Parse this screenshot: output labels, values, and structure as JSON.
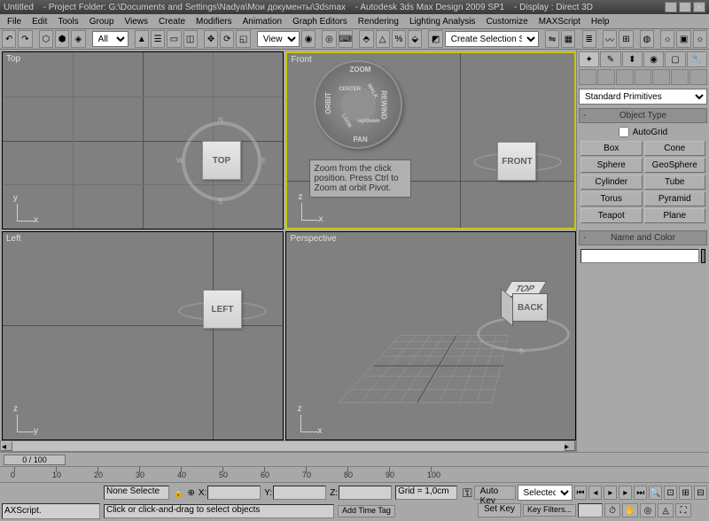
{
  "titlebar": {
    "untitled": "Untitled",
    "project": "- Project Folder: G:\\Documents and Settings\\Nadya\\Мои документы\\3dsmax",
    "app": "- Autodesk 3ds Max Design 2009 SP1",
    "display": "- Display : Direct 3D"
  },
  "menu": [
    "File",
    "Edit",
    "Tools",
    "Group",
    "Views",
    "Create",
    "Modifiers",
    "Animation",
    "Graph Editors",
    "Rendering",
    "Lighting Analysis",
    "Customize",
    "MAXScript",
    "Help"
  ],
  "toolbar": {
    "all_dropdown": "All",
    "view_dropdown": "View",
    "selection_set": "Create Selection Set"
  },
  "viewports": {
    "top": {
      "label": "Top",
      "cube": "TOP"
    },
    "front": {
      "label": "Front",
      "cube": "FRONT"
    },
    "left": {
      "label": "Left",
      "cube": "LEFT"
    },
    "perspective": {
      "label": "Perspective",
      "cube_top": "TOP",
      "cube_back": "BACK"
    }
  },
  "steering_wheel": {
    "segments": [
      "ZOOM",
      "REWIND",
      "PAN",
      "ORBIT",
      "CENTER",
      "WALK",
      "LOOK",
      "up/down"
    ],
    "tooltip": "Zoom from the click position. Press Ctrl to Zoom at orbit Pivot."
  },
  "compass": [
    "N",
    "E",
    "S",
    "W"
  ],
  "command_panel": {
    "dropdown": "Standard Primitives",
    "object_type": "Object Type",
    "autogrid": "AutoGrid",
    "buttons": [
      "Box",
      "Cone",
      "Sphere",
      "GeoSphere",
      "Cylinder",
      "Tube",
      "Torus",
      "Pyramid",
      "Teapot",
      "Plane"
    ],
    "name_and_color": "Name and Color"
  },
  "timeline": {
    "slider": "0 / 100"
  },
  "ruler_ticks": [
    0,
    10,
    20,
    30,
    40,
    50,
    60,
    70,
    80,
    90,
    100
  ],
  "status": {
    "axscript": "AXScript.",
    "none_selected": "None Selecte",
    "hint": "Click or click-and-drag to select objects",
    "x": "X:",
    "y": "Y:",
    "z": "Z:",
    "grid": "Grid = 1,0cm",
    "add_time_tag": "Add Time Tag",
    "auto_key": "Auto Key",
    "set_key": "Set Key",
    "selected": "Selected",
    "key_filters": "Key Filters..."
  }
}
